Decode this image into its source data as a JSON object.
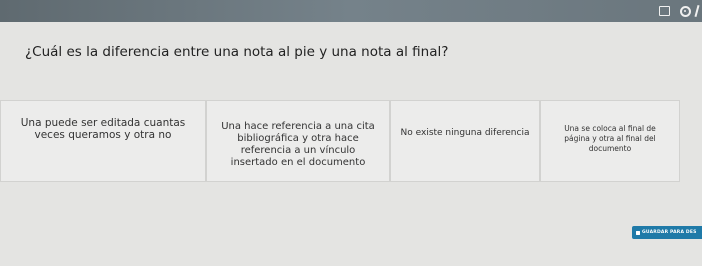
{
  "quiz": {
    "question": "¿Cuál es la diferencia entre una nota al pie y una nota al final?",
    "options": [
      {
        "label": "Una puede ser editada cuantas\nveces queramos y otra no"
      },
      {
        "label": "Una hace referencia a una cita\nbibliográfica y otra hace\nreferencia a un vínculo\ninsertado en el documento"
      },
      {
        "label": "No existe ninguna diferencia"
      },
      {
        "label": "Una se coloca al final de\npágina y otra al final del\ndocumento"
      }
    ],
    "save_label": "GUARDAR PARA DES"
  },
  "icons": {
    "toolbar": [
      "screen-icon",
      "settings-icon",
      "pen-icon"
    ],
    "save": "save-icon"
  }
}
